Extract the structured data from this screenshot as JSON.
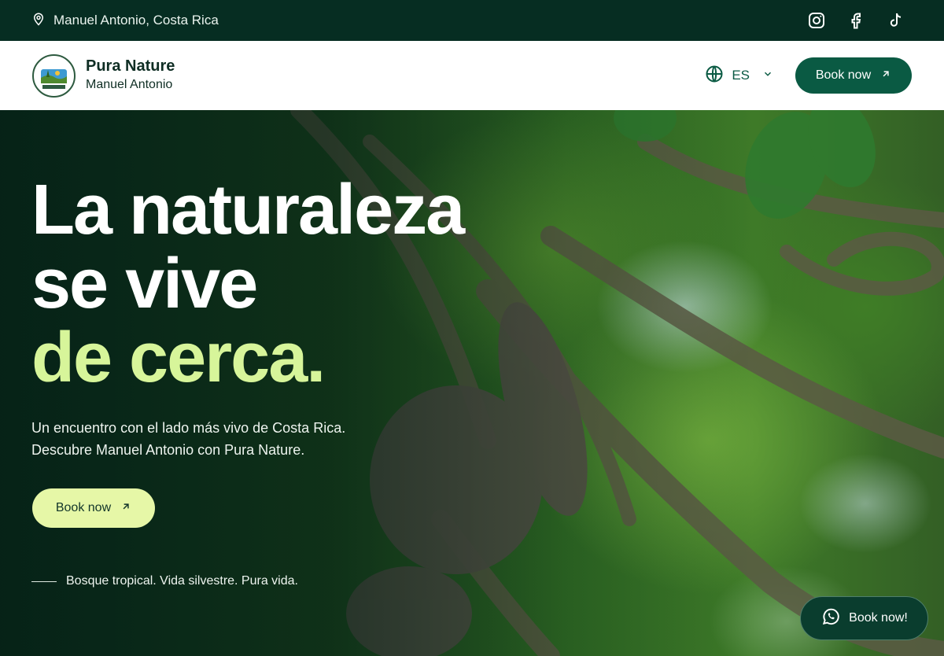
{
  "topbar": {
    "location": "Manuel Antonio, Costa Rica",
    "socials": [
      "instagram-icon",
      "facebook-icon",
      "tiktok-icon"
    ]
  },
  "header": {
    "brand_name": "Pura Nature",
    "brand_sub": "Manuel Antonio",
    "logo_text": "PURA NATURE",
    "language": "ES",
    "book_label": "Book now"
  },
  "hero": {
    "headline_line1": "La naturaleza",
    "headline_line2": "se vive",
    "headline_line3": "de cerca.",
    "sub_line1": "Un encuentro con el lado más vivo de Costa Rica.",
    "sub_line2": "Descubre Manuel Antonio con Pura Nature.",
    "book_label": "Book now",
    "tagline": "Bosque tropical. Vida silvestre. Pura vida."
  },
  "floating": {
    "whatsapp_label": "Book now!"
  },
  "colors": {
    "topbar_bg": "#062d22",
    "primary": "#0a5a43",
    "accent": "#d7f59a",
    "hero_button": "#e6f7a7"
  }
}
